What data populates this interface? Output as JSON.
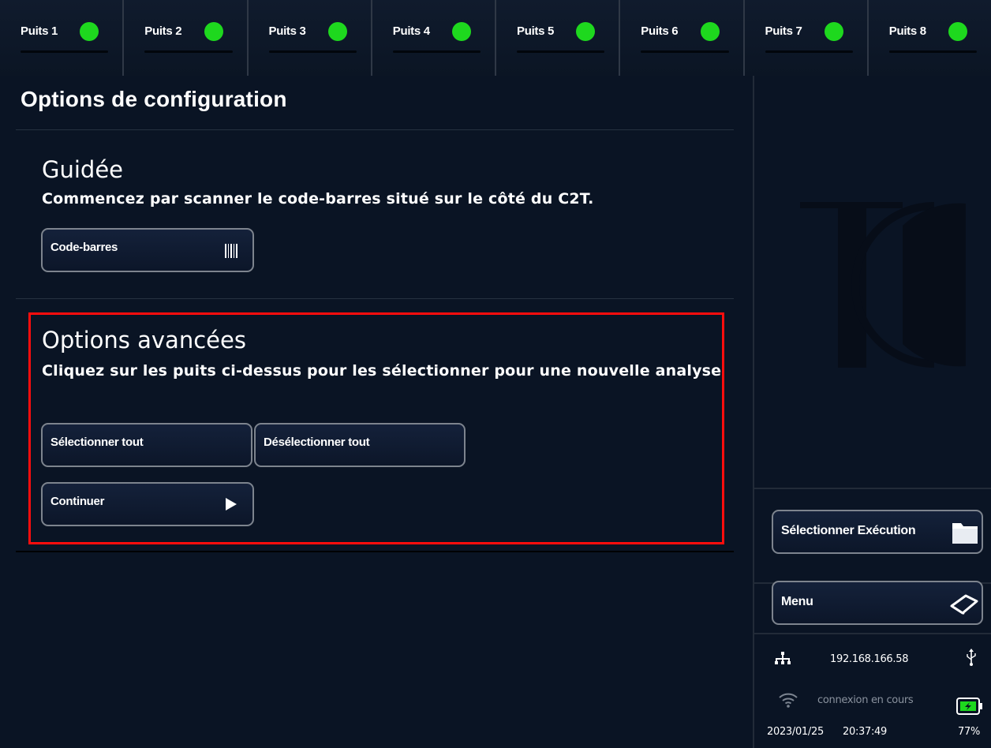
{
  "wells": [
    {
      "label": "Puits 1",
      "status_color": "#1ed81e"
    },
    {
      "label": "Puits 2",
      "status_color": "#1ed81e"
    },
    {
      "label": "Puits 3",
      "status_color": "#1ed81e"
    },
    {
      "label": "Puits 4",
      "status_color": "#1ed81e"
    },
    {
      "label": "Puits 5",
      "status_color": "#1ed81e"
    },
    {
      "label": "Puits 6",
      "status_color": "#1ed81e"
    },
    {
      "label": "Puits 7",
      "status_color": "#1ed81e"
    },
    {
      "label": "Puits 8",
      "status_color": "#1ed81e"
    }
  ],
  "main": {
    "title": "Options de configuration",
    "guided": {
      "title": "Guidée",
      "description": "Commencez par scanner le code-barres situé sur le côté du C2T.",
      "barcode_button": "Code-barres",
      "barcode_icon": "barcode-icon"
    },
    "advanced": {
      "title": "Options avancées",
      "description": "Cliquez sur les puits ci-dessus pour les sélectionner pour une nouvelle analyse",
      "select_all_button": "Sélectionner tout",
      "deselect_all_button": "Désélectionner tout",
      "continue_button": "Continuer",
      "continue_icon": "play-icon"
    }
  },
  "sidebar": {
    "logo_icon": "brand-logo-icon",
    "select_run_button": "Sélectionner Exécution",
    "select_run_icon": "folder-icon",
    "menu_button": "Menu",
    "menu_icon": "book-icon",
    "network": {
      "icon": "network-icon",
      "ip": "192.168.166.58",
      "usb_icon": "usb-icon"
    },
    "wifi": {
      "icon": "wifi-icon",
      "status": "connexion en cours",
      "battery_icon": "battery-icon"
    },
    "date": "2023/01/25",
    "time": "20:37:49",
    "battery": "77%"
  },
  "colors": {
    "accent_highlight": "#ff0d0d",
    "status_ok": "#1ed81e",
    "background": "#0a1424"
  }
}
